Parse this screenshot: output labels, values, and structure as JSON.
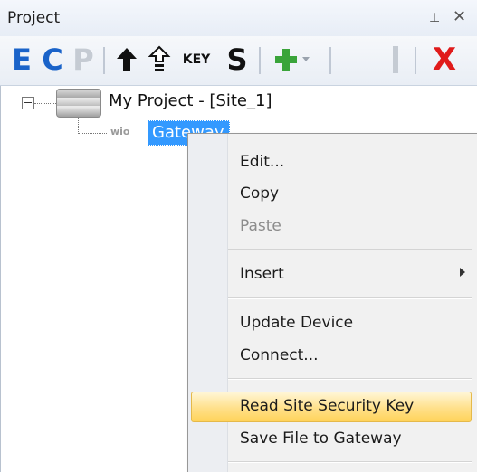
{
  "panel": {
    "title": "Project",
    "pin_glyph": "⊥",
    "close_glyph": "✕"
  },
  "toolbar": {
    "btn_e": "E",
    "btn_c": "C",
    "btn_p": "P",
    "btn_key": "KEY",
    "btn_s": "S",
    "btn_x": "X",
    "icons": [
      "up-arrow-icon",
      "move-up-icon",
      "add-icon",
      "dropdown-icon",
      "divider-icon",
      "delete-icon"
    ],
    "colors": {
      "blue": "#1a63c9",
      "disabled": "#c5cbd3",
      "green": "#3aa43a",
      "red": "#e01b1b"
    }
  },
  "tree": {
    "root_label": "My Project - [Site_1]",
    "child_type": "wio",
    "child_label": "Gateway",
    "selection_color": "#3399ff"
  },
  "context_menu": {
    "items": [
      {
        "label": "Edit...",
        "enabled": true
      },
      {
        "label": "Copy",
        "enabled": true
      },
      {
        "label": "Paste",
        "enabled": false
      },
      {
        "label": "Insert",
        "enabled": true,
        "submenu": true
      },
      {
        "label": "Update Device",
        "enabled": true
      },
      {
        "label": "Connect...",
        "enabled": true
      },
      {
        "label": "Read Site Security Key",
        "enabled": true,
        "highlighted": true
      },
      {
        "label": "Save File to Gateway",
        "enabled": true
      }
    ]
  }
}
